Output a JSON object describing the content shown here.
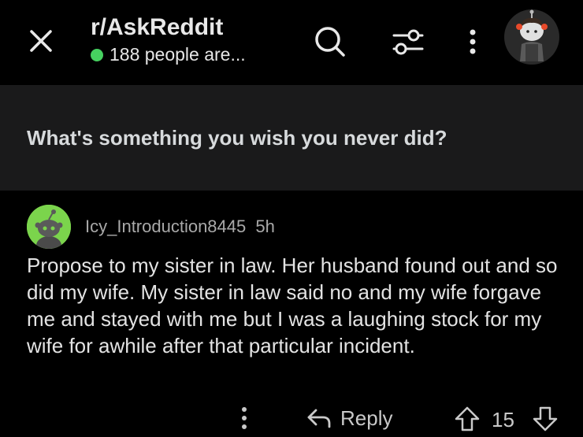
{
  "header": {
    "subreddit": "r/AskReddit",
    "online_text": "188 people are...",
    "icons": {
      "close": "close-icon",
      "search": "search-icon",
      "filter": "filter-sliders-icon",
      "more": "more-vertical-icon",
      "avatar": "user-avatar"
    }
  },
  "post": {
    "title": "What's something you wish you never did?"
  },
  "comment": {
    "username": "Icy_Introduction8445",
    "time": "5h",
    "body": "Propose to my sister in law. Her husband found out and so did my wife. My sister in law said no and my wife forgave me and stayed with me but I was a laughing stock for my wife for awhile after that particular incident.",
    "actions": {
      "reply_label": "Reply",
      "vote_count": "15"
    }
  },
  "colors": {
    "background": "#000000",
    "post_band": "#1a1a1b",
    "online_dot": "#46d160",
    "comment_avatar": "#7bd44c"
  }
}
